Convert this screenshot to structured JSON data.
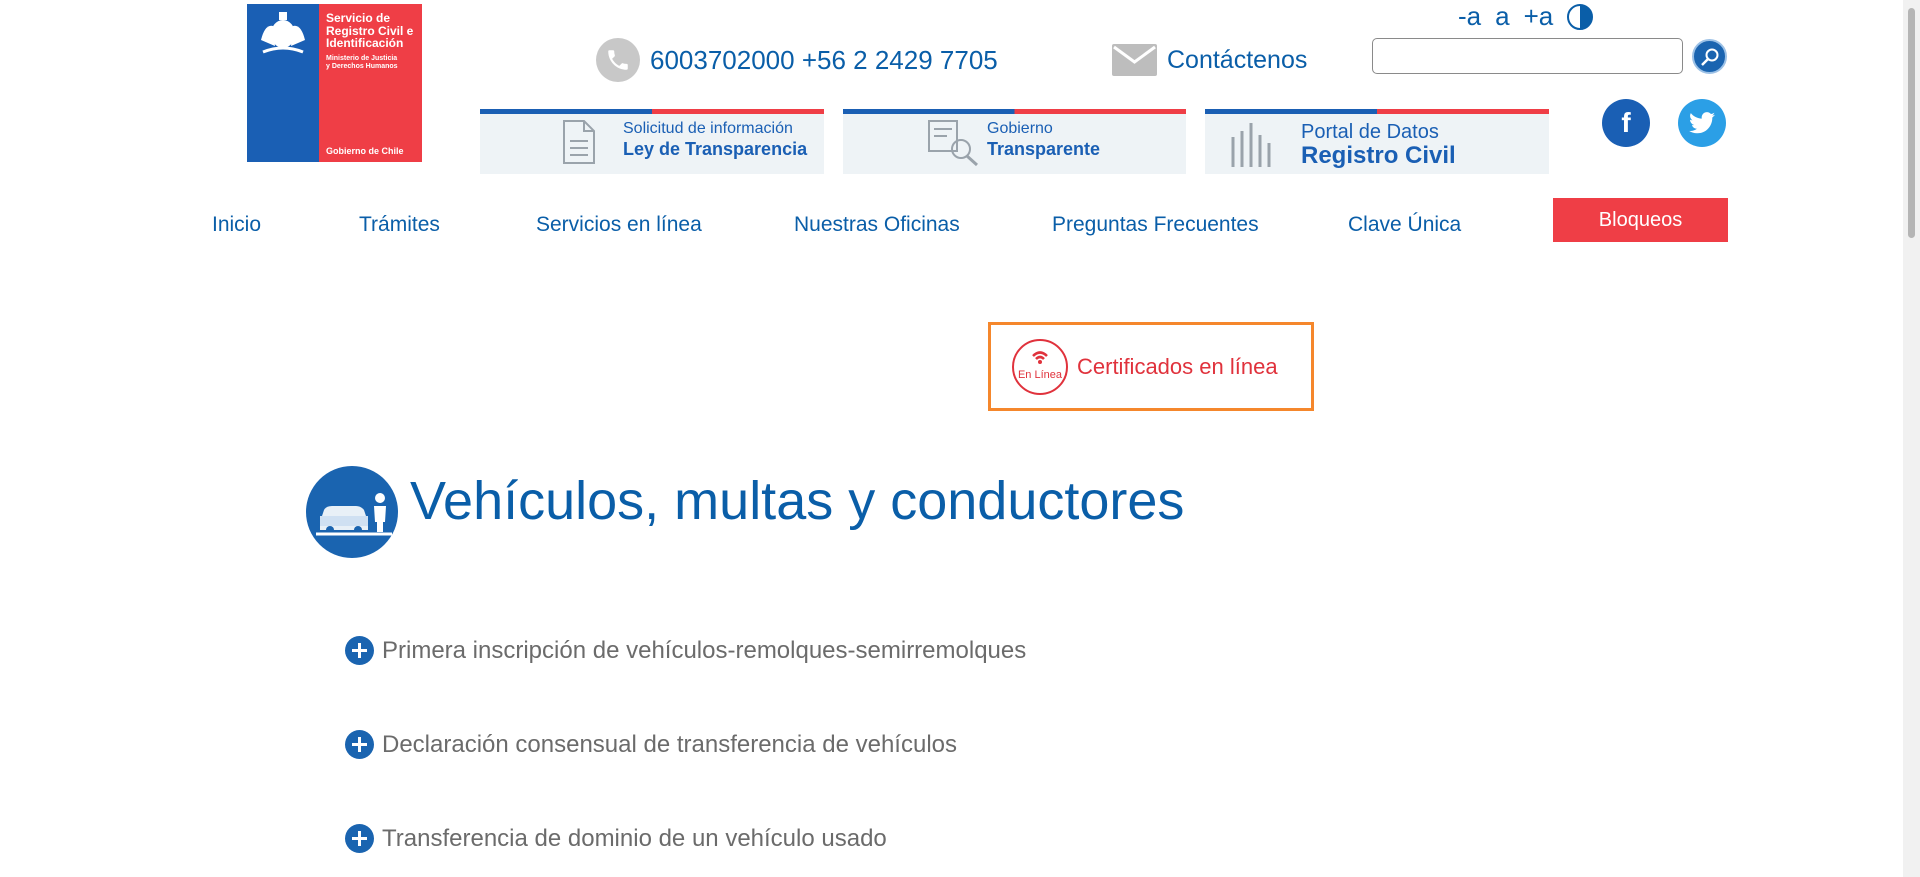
{
  "logo": {
    "name_line1": "Servicio de",
    "name_line2": "Registro Civil e",
    "name_line3": "Identificación",
    "ministry_line1": "Ministerio de Justicia",
    "ministry_line2": "y Derechos Humanos",
    "government": "Gobierno de Chile"
  },
  "header": {
    "phone": "6003702000 +56 2 2429 7705",
    "contact": "Contáctenos",
    "font_decrease": "-a",
    "font_normal": "a",
    "font_increase": "+a",
    "search_value": ""
  },
  "banners": {
    "transparencia_small": "Solicitud de información",
    "transparencia_big": "Ley de Transparencia",
    "gobierno_small": "Gobierno",
    "gobierno_big": "Transparente",
    "datos_small": "Portal de Datos",
    "datos_big": "Registro Civil"
  },
  "social": {
    "facebook": "f"
  },
  "nav": {
    "inicio": "Inicio",
    "tramites": "Trámites",
    "servicios": "Servicios en línea",
    "oficinas": "Nuestras Oficinas",
    "preguntas": "Preguntas Frecuentes",
    "clave": "Clave Única",
    "bloqueos": "Bloqueos"
  },
  "certificates": {
    "badge": "En Línea",
    "label": "Certificados en línea"
  },
  "section": {
    "title": "Vehículos, multas y conductores"
  },
  "items": [
    "Primera inscripción de vehículos-remolques-semirremolques",
    "Declaración consensual de transferencia de vehículos",
    "Transferencia de dominio de un vehículo usado"
  ],
  "colors": {
    "brand_blue": "#1a5fb4",
    "brand_red": "#ef3e46",
    "highlight_orange": "#f5872c"
  }
}
